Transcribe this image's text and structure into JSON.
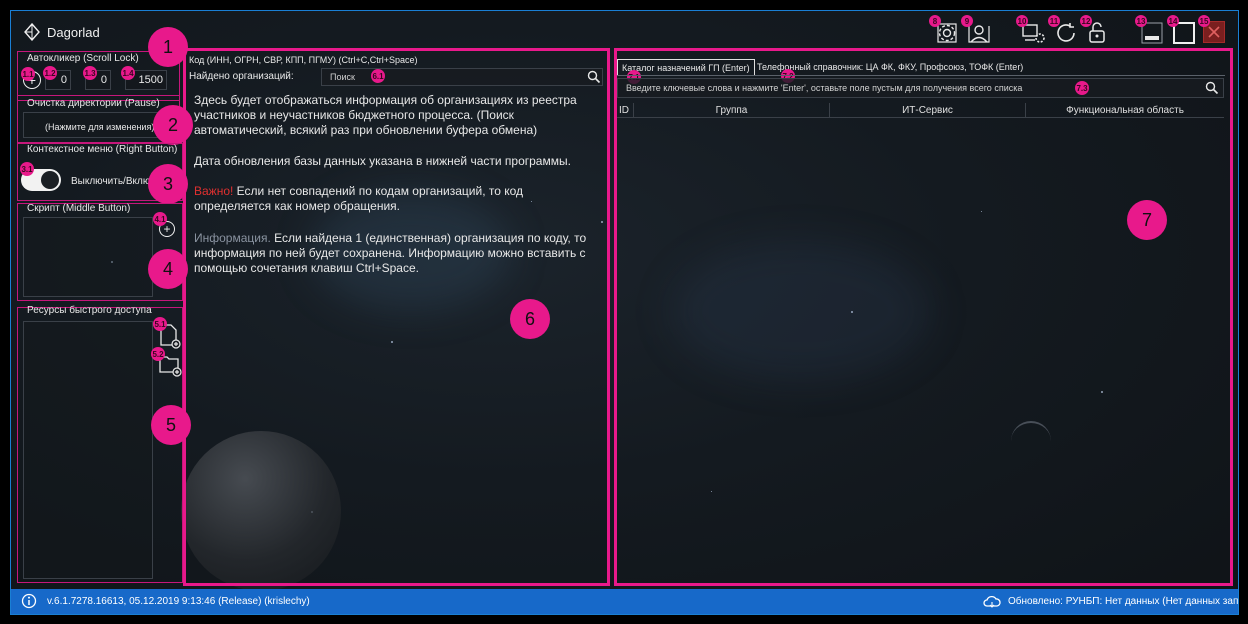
{
  "app": {
    "title": "Dagorlad",
    "accent": "#e8198b",
    "status_bar_color": "#1769c9"
  },
  "titlebar": {
    "icons": [
      {
        "name": "settings-icon",
        "badge": "8"
      },
      {
        "name": "user-card-icon",
        "badge": "9"
      },
      {
        "name": "device-settings-icon",
        "badge": "10"
      },
      {
        "name": "refresh-icon",
        "badge": "11"
      },
      {
        "name": "lock-open-icon",
        "badge": "12"
      },
      {
        "name": "minimize-icon",
        "badge": "13"
      },
      {
        "name": "maximize-icon",
        "badge": "14"
      },
      {
        "name": "close-icon",
        "badge": "15"
      }
    ]
  },
  "left": {
    "autoclicker": {
      "title": "Автокликер (Scroll Lock)",
      "value1": "0",
      "value2": "0",
      "value3": "1500",
      "badges": [
        "1.1",
        "1.2",
        "1.3",
        "1.4"
      ],
      "section_badge": "1"
    },
    "cleanup": {
      "title": "Очистка директории (Pause)",
      "hint": "(Нажмите для изменения)",
      "section_badge": "2"
    },
    "context_menu": {
      "title": "Контекстное меню (Right Button)",
      "toggle_label": "Выключить/Включ",
      "badge": "3.1",
      "section_badge": "3"
    },
    "script": {
      "title": "Скрипт (Middle Button)",
      "badge": "4.1",
      "section_badge": "4"
    },
    "resources": {
      "title": "Ресурсы быстрого доступа",
      "badges": [
        "5.1",
        "5.2"
      ],
      "section_badge": "5"
    }
  },
  "middle": {
    "code_label": "Код (ИНН, ОГРН, СВР, КПП, ПГМУ) (Ctrl+C,Ctrl+Space)",
    "found_label": "Найдено организаций:",
    "search_placeholder": "Поиск",
    "search_badge": "6.1",
    "section_badge": "6",
    "para1": "Здесь будет отображаться информация об организациях из реестра участников и неучастников бюджетного процесса. (Поиск автоматический, всякий раз при обновлении буфера обмена)",
    "para2": "Дата обновления базы данных указана в нижней части программы.",
    "para3_prefix": "Важно!",
    "para3_text": " Если нет совпадений по кодам организаций, то код определяется как номер обращения.",
    "para4_prefix": "Информация.",
    "para4_text": " Если найдена 1 (единственная) организация по коду, то информация по ней будет сохранена. Информацию можно вставить с помощью сочетания клавиш Ctrl+Space."
  },
  "right": {
    "tabs": [
      {
        "label": "Каталог назначений ГП (Enter)",
        "badge": "7.1"
      },
      {
        "label": "Телефонный справочник: ЦА ФК, ФКУ, Профсоюз, ТОФК (Enter)",
        "badge": "7.2"
      }
    ],
    "search_hint": "Введите ключевые слова и нажмите 'Enter', оставьте поле пустым для получения всего списка",
    "search_badge": "7.3",
    "columns": [
      "ID",
      "Группа",
      "ИТ-Сервис",
      "Функциональная область"
    ],
    "section_badge": "7"
  },
  "statusbar": {
    "version": "v.6.1.7278.16613, 05.12.2019 9:13:46 (Release) (krislechy)",
    "update": "Обновлено: РУНБП: Нет данных (Нет данных записей)"
  }
}
